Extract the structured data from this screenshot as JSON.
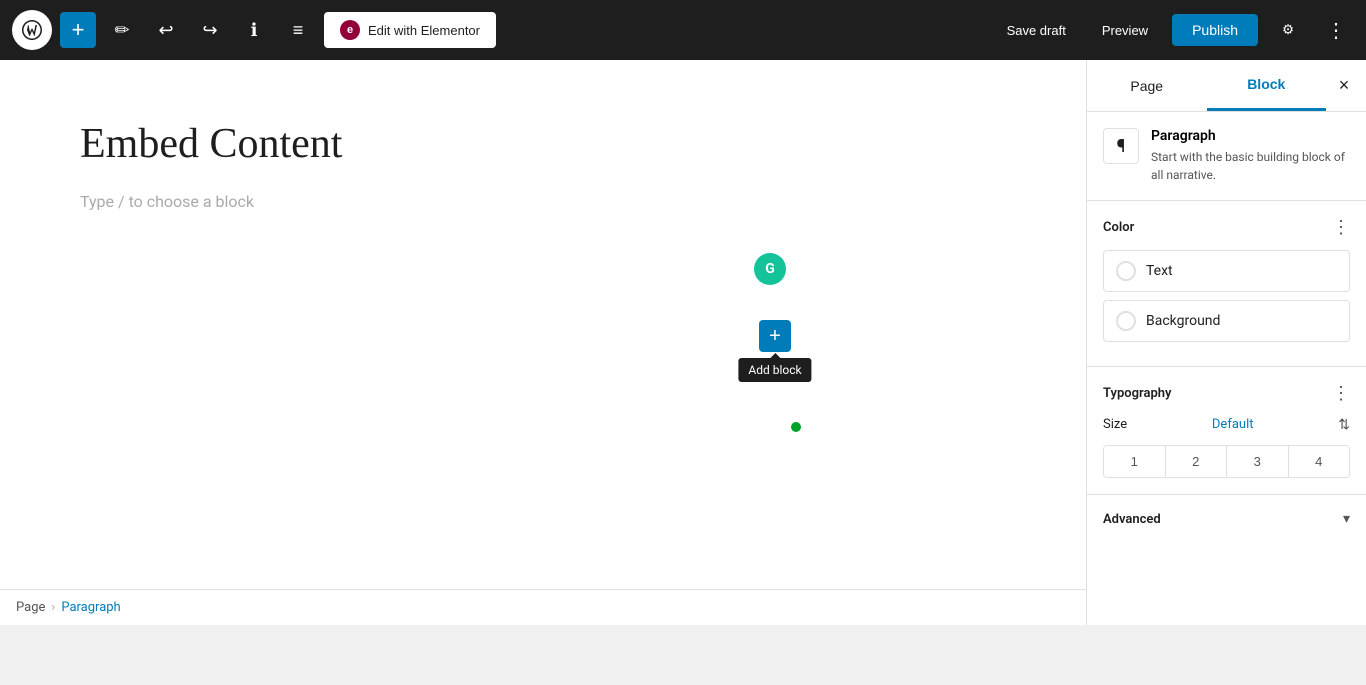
{
  "toolbar": {
    "add_label": "+",
    "undo_label": "↩",
    "redo_label": "↪",
    "info_label": "ℹ",
    "list_label": "≡",
    "elementor_label": "Edit with Elementor",
    "save_draft_label": "Save draft",
    "preview_label": "Preview",
    "publish_label": "Publish"
  },
  "editor": {
    "page_title": "Embed Content",
    "block_placeholder": "Type / to choose a block",
    "add_block_tooltip": "Add block"
  },
  "sidebar": {
    "page_tab": "Page",
    "block_tab": "Block",
    "close_label": "×",
    "block_name": "Paragraph",
    "block_description": "Start with the basic building block of all narrative.",
    "color_section_title": "Color",
    "color_text_label": "Text",
    "color_background_label": "Background",
    "typography_section_title": "Typography",
    "size_label": "Size",
    "size_default": "Default",
    "size_options": [
      "1",
      "2",
      "3",
      "4"
    ],
    "advanced_section_title": "Advanced"
  },
  "breadcrumb": {
    "page_label": "Page",
    "separator": "›",
    "current_label": "Paragraph"
  }
}
